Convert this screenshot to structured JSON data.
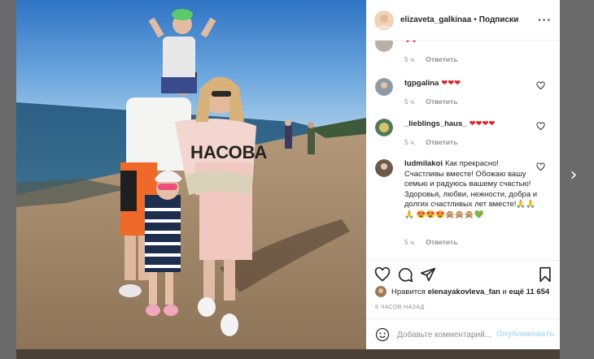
{
  "colors": {
    "accent_disabled": "#b2dffc",
    "heart": "#ed1c24",
    "muted": "#8e8e8e",
    "text": "#262626"
  },
  "photo": {
    "alt": "Family on beach",
    "shirt_text": "НАСОВА"
  },
  "header": {
    "username": "elizaveta_galkinaa",
    "separator": "•",
    "follow_label": "Подписки",
    "more_icon": "more-horizontal-icon"
  },
  "comments": [
    {
      "username": "",
      "text": "❤❤",
      "time": "5 ч.",
      "reply": "Ответить"
    },
    {
      "username": "tgpgalina",
      "text": "❤❤❤",
      "time": "5 ч.",
      "reply": "Ответить"
    },
    {
      "username": "_lieblings_haus_",
      "text": "❤❤❤❤",
      "time": "5 ч.",
      "reply": "Ответить"
    },
    {
      "username": "ludmilakoi",
      "text": "Как прекрасно! Счастливы вместе! Обожаю вашу семью и радуюсь вашему счастью! Здоровья, любви, нежности, добра и долгих счастливых лет вместе!🙏🙏🙏 😍😍😍🙊🙊🙊💚",
      "time": "5 ч.",
      "reply": "Ответить"
    }
  ],
  "actions": {
    "icons": [
      "heart-icon",
      "comment-icon",
      "share-icon",
      "bookmark-icon"
    ]
  },
  "likes": {
    "prefix": "Нравится",
    "user": "elenayakovleva_fan",
    "middle": "и",
    "count": "ещё 11 654"
  },
  "timestamp": "8 ЧАСОВ НАЗАД",
  "add_comment": {
    "placeholder": "Добавьте комментарий...",
    "button": "Опубликовать"
  },
  "navigation": {
    "next_label": "›"
  }
}
